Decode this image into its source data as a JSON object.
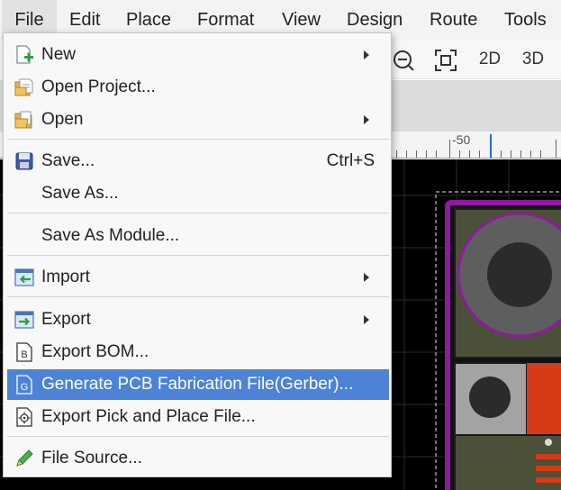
{
  "menubar": {
    "items": [
      "File",
      "Edit",
      "Place",
      "Format",
      "View",
      "Design",
      "Route",
      "Tools"
    ]
  },
  "toolbar": {
    "zoom_out_icon": "zoom-out-icon",
    "fit_icon": "fit-view-icon",
    "view_2d": "2D",
    "view_3d": "3D"
  },
  "ruler": {
    "label": "-50"
  },
  "file_menu": {
    "new": "New",
    "open_project": "Open Project...",
    "open": "Open",
    "save": "Save...",
    "save_shortcut": "Ctrl+S",
    "save_as": "Save As...",
    "save_as_module": "Save As Module...",
    "import": "Import",
    "export": "Export",
    "export_bom": "Export BOM...",
    "generate_gerber": "Generate PCB Fabrication File(Gerber)...",
    "export_pick_place": "Export Pick and Place File...",
    "file_source": "File Source..."
  },
  "colors": {
    "highlight": "#4d83d6",
    "board_outline": "#8e1aa0",
    "pad_red": "#d63a17",
    "copper_olive": "#4b5039"
  }
}
